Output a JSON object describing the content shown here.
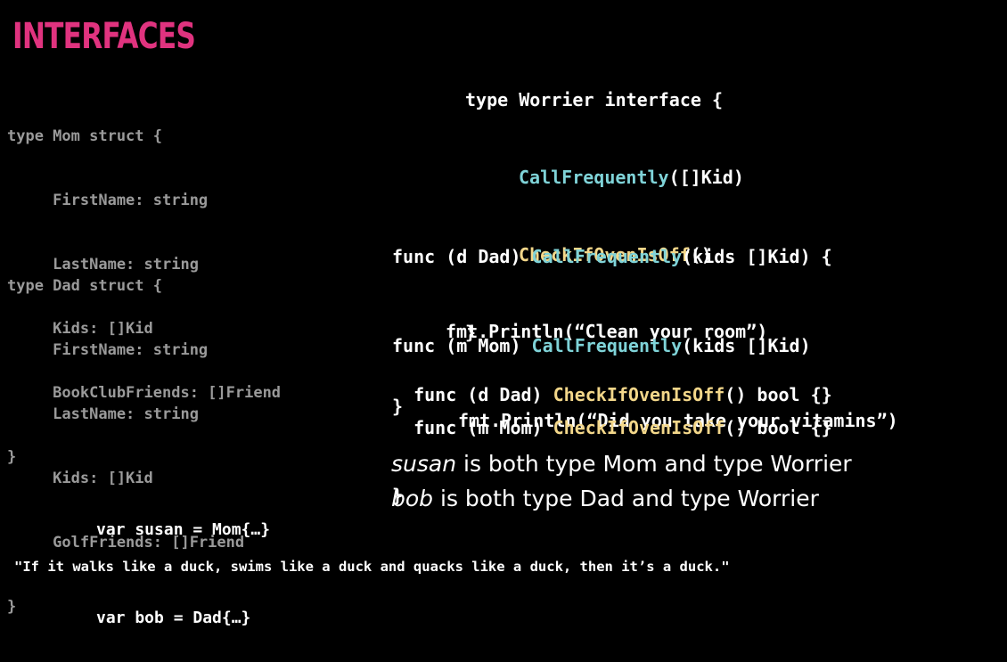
{
  "title": "INTERFACES",
  "mom_struct": [
    "type Mom struct {",
    "     FirstName: string",
    "     LastName: string",
    "     Kids: []Kid",
    "     BookClubFriends: []Friend",
    "}"
  ],
  "dad_struct": [
    "type Dad struct {",
    "     FirstName: string",
    "     LastName: string",
    "     Kids: []Kid",
    "     GolfFriends: []Friend",
    "}"
  ],
  "worrier": {
    "header": "type Worrier interface {",
    "method1_name": "CallFrequently",
    "method1_sig": "([]Kid)",
    "method2_name": "CheckIfOvenIsOff",
    "method2_sig": "()",
    "close": "}"
  },
  "dad_call": {
    "prefix": "func (d Dad) ",
    "name": "CallFrequently",
    "suffix": "(kids []Kid) {",
    "body": "fmt.Println(“Clean your room”)",
    "close": "}"
  },
  "mom_call": {
    "prefix": "func (m Mom) ",
    "name": "CallFrequently",
    "suffix": "(kids []Kid)",
    "body": "fmt.Println(“Did you take your vitamins”)",
    "close": "}"
  },
  "dad_oven": {
    "prefix": "func (d Dad) ",
    "name": "CheckIfOvenIsOff",
    "suffix": "() bool {}"
  },
  "mom_oven": {
    "prefix": "func (m Mom) ",
    "name": "CheckIfOvenIsOff",
    "suffix": "() bool {}"
  },
  "vars": [
    "var susan = Mom{…}",
    "var bob = Dad{…}"
  ],
  "susan_line": {
    "name": "susan",
    "rest": " is both type Mom and type Worrier"
  },
  "bob_line": {
    "name": "bob",
    "rest": " is both type Dad and type Worrier"
  },
  "quote": "\"If it walks like a duck, swims like a duck and quacks like a duck, then it’s a duck.\""
}
